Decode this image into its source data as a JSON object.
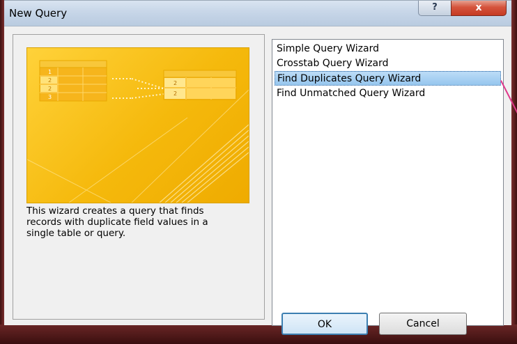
{
  "window": {
    "title": "New Query",
    "help_glyph": "?",
    "close_glyph": "x"
  },
  "description": "This wizard creates a query that finds records with duplicate field values in a single table or query.",
  "preview": {
    "left_rows": [
      "1",
      "2",
      "2",
      "3"
    ],
    "right_rows": [
      "2",
      "2"
    ]
  },
  "list": {
    "items": [
      {
        "label": "Simple Query Wizard",
        "selected": false
      },
      {
        "label": "Crosstab Query Wizard",
        "selected": false
      },
      {
        "label": "Find Duplicates Query Wizard",
        "selected": true
      },
      {
        "label": "Find Unmatched Query Wizard",
        "selected": false
      }
    ]
  },
  "buttons": {
    "ok_label": "OK",
    "cancel_label": "Cancel"
  },
  "colors": {
    "selection": "#96c6ee",
    "preview_yellow": "#f5b90c",
    "frame": "#5a1f1f"
  }
}
